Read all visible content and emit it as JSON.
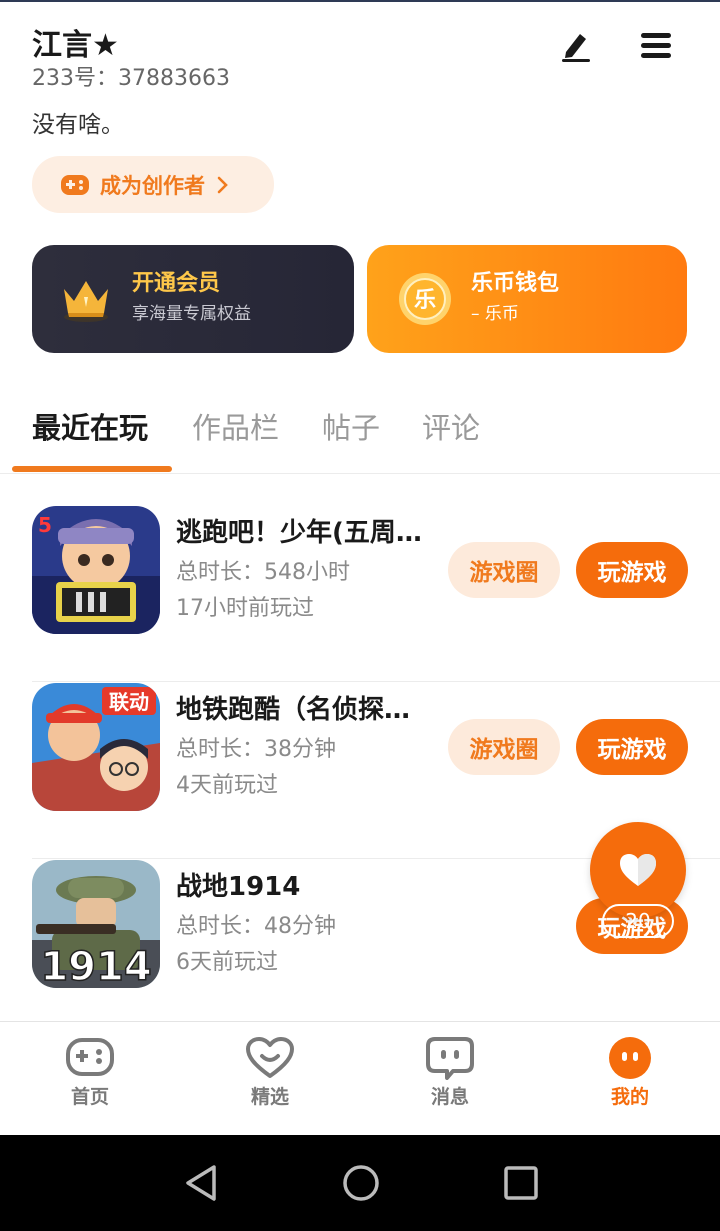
{
  "profile": {
    "name": "江言★",
    "uid": "233号：37883663",
    "bio": "没有啥。"
  },
  "creator_button": {
    "label": "成为创作者"
  },
  "vip_card": {
    "title": "开通会员",
    "subtitle": "享海量专属权益"
  },
  "coin_card": {
    "title": "乐币钱包",
    "subtitle": "– 乐币",
    "coin_glyph": "乐"
  },
  "tabs": [
    {
      "label": "最近在玩",
      "active": true
    },
    {
      "label": "作品栏"
    },
    {
      "label": "帖子"
    },
    {
      "label": "评论"
    }
  ],
  "games": [
    {
      "title": "逃跑吧！少年(五周…",
      "playtime": "总时长：548小时",
      "last_played": "17小时前玩过",
      "circle_label": "游戏圈",
      "play_label": "玩游戏"
    },
    {
      "title": "地铁跑酷（名侦探…",
      "playtime": "总时长：38分钟",
      "last_played": "4天前玩过",
      "circle_label": "游戏圈",
      "play_label": "玩游戏"
    },
    {
      "title": "战地1914",
      "playtime": "总时长：48分钟",
      "last_played": "6天前玩过",
      "play_label": "玩游戏"
    }
  ],
  "like": {
    "count": "20"
  },
  "bottom_nav": [
    {
      "label": "首页",
      "icon": "gamepad-icon"
    },
    {
      "label": "精选",
      "icon": "heart-face-icon"
    },
    {
      "label": "消息",
      "icon": "chat-icon"
    },
    {
      "label": "我的",
      "icon": "profile-face-icon",
      "active": true
    }
  ],
  "colors": {
    "accent": "#f56c0c",
    "accent_light": "#fdeadb",
    "vip_bg": "#2b2b3a",
    "vip_text": "#ffc84a"
  }
}
